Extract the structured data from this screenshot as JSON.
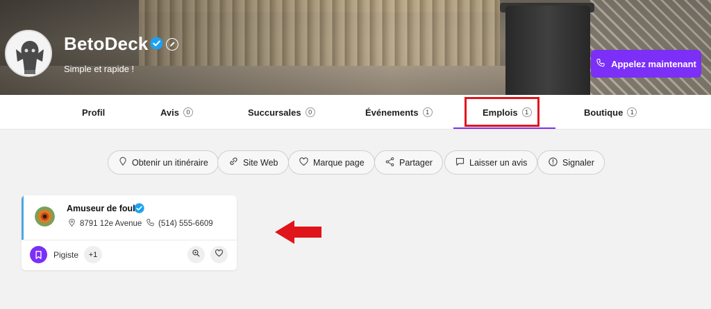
{
  "header": {
    "brand_name": "BetoDeck",
    "tagline": "Simple et rapide !",
    "call_button_label": "Appelez maintenant"
  },
  "tabs": [
    {
      "label": "Profil",
      "count": null
    },
    {
      "label": "Avis",
      "count": "0"
    },
    {
      "label": "Succursales",
      "count": "0"
    },
    {
      "label": "Événements",
      "count": "1"
    },
    {
      "label": "Emplois",
      "count": "1",
      "active": true
    },
    {
      "label": "Boutique",
      "count": "1"
    }
  ],
  "actions": [
    {
      "label": "Obtenir un itinéraire",
      "icon": "map-pin-icon"
    },
    {
      "label": "Site Web",
      "icon": "link-icon"
    },
    {
      "label": "Marque page",
      "icon": "heart-icon"
    },
    {
      "label": "Partager",
      "icon": "share-icon"
    },
    {
      "label": "Laisser un avis",
      "icon": "comment-icon"
    },
    {
      "label": "Signaler",
      "icon": "alert-icon"
    }
  ],
  "listing": {
    "title": "Amuseur de foule",
    "address": "8791 12e Avenue",
    "phone": "(514) 555-6609",
    "category": "Pigiste",
    "more_count": "+1"
  },
  "colors": {
    "accent": "#7b2ff7",
    "verified": "#1da1f2",
    "annotation_red": "#e0141b"
  }
}
